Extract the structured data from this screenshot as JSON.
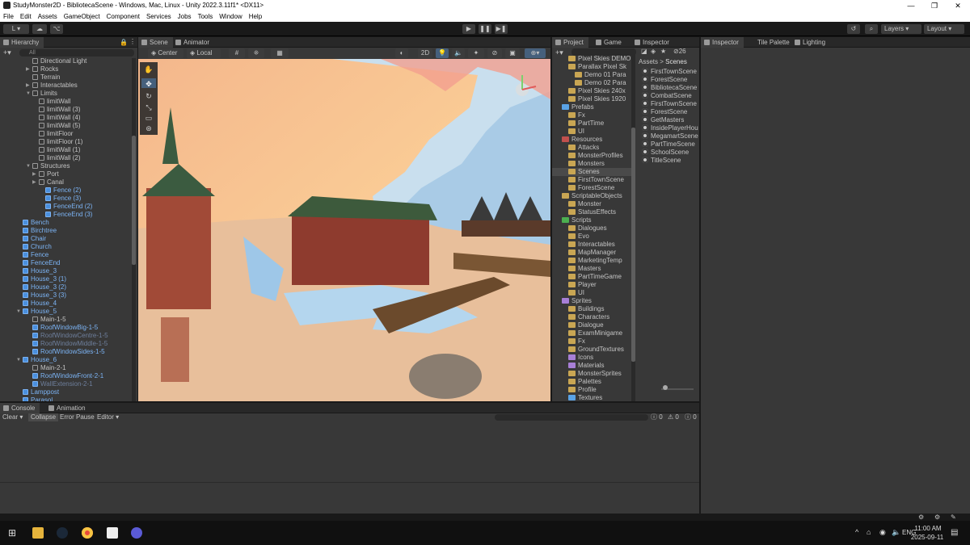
{
  "window": {
    "title": "StudyMonster2D - BibliotecaScene - Windows, Mac, Linux - Unity 2022.3.11f1* <DX11>",
    "controls": [
      "—",
      "❐",
      "✕"
    ]
  },
  "menu": [
    "File",
    "Edit",
    "Assets",
    "GameObject",
    "Component",
    "Services",
    "Jobs",
    "Tools",
    "Window",
    "Help"
  ],
  "toolbar": {
    "account": "L ▾",
    "layers": "Layers",
    "layout": "Layout"
  },
  "hierarchy": {
    "tab": "Hierarchy",
    "search_placeholder": "All",
    "rows": [
      {
        "label": "Directional Light",
        "style": "n"
      },
      {
        "label": "Rocks",
        "style": "n"
      },
      {
        "label": "Terrain",
        "style": "n"
      },
      {
        "label": "Interactables",
        "style": "n"
      },
      {
        "label": "Limits",
        "style": "n"
      },
      {
        "label": "limitWall",
        "style": "n"
      },
      {
        "label": "limitWall (3)",
        "style": "n"
      },
      {
        "label": "limitWall (4)",
        "style": "n"
      },
      {
        "label": "limitWall (5)",
        "style": "n"
      },
      {
        "label": "limitFloor",
        "style": "n"
      },
      {
        "label": "limitFloor (1)",
        "style": "n"
      },
      {
        "label": "limitWall (1)",
        "style": "n"
      },
      {
        "label": "limitWall (2)",
        "style": "n"
      },
      {
        "label": "Structures",
        "style": "n"
      },
      {
        "label": "Port",
        "style": "n"
      },
      {
        "label": "Canal",
        "style": "n"
      },
      {
        "label": "Fence (2)",
        "style": "b"
      },
      {
        "label": "Fence (3)",
        "style": "b"
      },
      {
        "label": "FenceEnd (2)",
        "style": "b"
      },
      {
        "label": "FenceEnd (3)",
        "style": "b"
      },
      {
        "label": "Bench",
        "style": "b"
      },
      {
        "label": "Birchtree",
        "style": "b"
      },
      {
        "label": "Chair",
        "style": "b"
      },
      {
        "label": "Church",
        "style": "b"
      },
      {
        "label": "Fence",
        "style": "b"
      },
      {
        "label": "FenceEnd",
        "style": "b"
      },
      {
        "label": "House_3",
        "style": "b"
      },
      {
        "label": "House_3 (1)",
        "style": "b"
      },
      {
        "label": "House_3 (2)",
        "style": "b"
      },
      {
        "label": "House_3 (3)",
        "style": "b"
      },
      {
        "label": "House_4",
        "style": "b"
      },
      {
        "label": "House_5",
        "style": "b"
      },
      {
        "label": "Main-1-5",
        "style": "n"
      },
      {
        "label": "RoofWindowBig-1-5",
        "style": "b"
      },
      {
        "label": "RoofWindowCentre-1-5",
        "style": "d"
      },
      {
        "label": "RoofWindowMiddle-1-5",
        "style": "d"
      },
      {
        "label": "RoofWindowSides-1-5",
        "style": "b"
      },
      {
        "label": "House_6",
        "style": "b"
      },
      {
        "label": "Main-2-1",
        "style": "n"
      },
      {
        "label": "RoofWindowFront-2-1",
        "style": "b"
      },
      {
        "label": "WallExtension-2-1",
        "style": "d"
      },
      {
        "label": "Lamppost",
        "style": "b"
      },
      {
        "label": "Parasol",
        "style": "b"
      }
    ]
  },
  "scene": {
    "tabs": [
      "Scene",
      "Animator"
    ],
    "pivot": "Center",
    "space": "Local",
    "mode2d": "2D",
    "badge": "26"
  },
  "project": {
    "tabs": [
      "Project",
      "Game",
      "Inspector"
    ],
    "breadcrumb": {
      "root": "Assets",
      "current": "Scenes"
    },
    "tree": [
      {
        "label": "Pixel Skies DEMO",
        "icon": "f"
      },
      {
        "label": "Parallax Pixel Sk",
        "icon": "f"
      },
      {
        "label": "Demo 01 Para",
        "icon": "f"
      },
      {
        "label": "Demo 02 Para",
        "icon": "f"
      },
      {
        "label": "Pixel Skies 240x",
        "icon": "f"
      },
      {
        "label": "Pixel Skies 1920",
        "icon": "f"
      },
      {
        "label": "Prefabs",
        "icon": "blue"
      },
      {
        "label": "Fx",
        "icon": "f"
      },
      {
        "label": "PartTime",
        "icon": "f"
      },
      {
        "label": "UI",
        "icon": "f"
      },
      {
        "label": "Resources",
        "icon": "red"
      },
      {
        "label": "Attacks",
        "icon": "f"
      },
      {
        "label": "MonsterProfiles",
        "icon": "f"
      },
      {
        "label": "Monsters",
        "icon": "f"
      },
      {
        "label": "Scenes",
        "icon": "f"
      },
      {
        "label": "FirstTownScene",
        "icon": "f"
      },
      {
        "label": "ForestScene",
        "icon": "f"
      },
      {
        "label": "ScriptableObjects",
        "icon": "f"
      },
      {
        "label": "Monster",
        "icon": "f"
      },
      {
        "label": "StatusEffects",
        "icon": "f"
      },
      {
        "label": "Scripts",
        "icon": "green"
      },
      {
        "label": "Dialogues",
        "icon": "f"
      },
      {
        "label": "Evo",
        "icon": "f"
      },
      {
        "label": "Interactables",
        "icon": "f"
      },
      {
        "label": "MapManager",
        "icon": "f"
      },
      {
        "label": "MarketingTemp",
        "icon": "f"
      },
      {
        "label": "Masters",
        "icon": "f"
      },
      {
        "label": "PartTimeGame",
        "icon": "f"
      },
      {
        "label": "Player",
        "icon": "f"
      },
      {
        "label": "UI",
        "icon": "f"
      },
      {
        "label": "Sprites",
        "icon": "purple"
      },
      {
        "label": "Buildings",
        "icon": "f"
      },
      {
        "label": "Characters",
        "icon": "f"
      },
      {
        "label": "Dialogue",
        "icon": "f"
      },
      {
        "label": "ExamMinigame",
        "icon": "f"
      },
      {
        "label": "Fx",
        "icon": "f"
      },
      {
        "label": "GroundTextures",
        "icon": "f"
      },
      {
        "label": "Icons",
        "icon": "purple"
      },
      {
        "label": "Materials",
        "icon": "purple"
      },
      {
        "label": "MonsterSprites",
        "icon": "f"
      },
      {
        "label": "Palettes",
        "icon": "f"
      },
      {
        "label": "Profile",
        "icon": "f"
      },
      {
        "label": "Textures",
        "icon": "blue"
      }
    ],
    "files": [
      "FirstTownScene",
      "ForestScene",
      "BibliotecaScene",
      "CombatScene",
      "FirstTownScene",
      "ForestScene",
      "GetMasters",
      "InsidePlayerHou",
      "MegamartScene",
      "PartTimeScene",
      "SchoolScene",
      "TitleScene"
    ]
  },
  "inspector": {
    "tabs": [
      "Inspector",
      "Tile Palette",
      "Lighting"
    ]
  },
  "console": {
    "tabs": [
      "Console",
      "Animation"
    ],
    "buttons": [
      "Clear",
      "Collapse",
      "Error Pause",
      "Editor"
    ],
    "counts": [
      "0",
      "0",
      "0"
    ]
  },
  "taskbar": {
    "lang": "ENG",
    "time": "11:00 AM",
    "date": "2025-09-11",
    "chevron": "^"
  }
}
